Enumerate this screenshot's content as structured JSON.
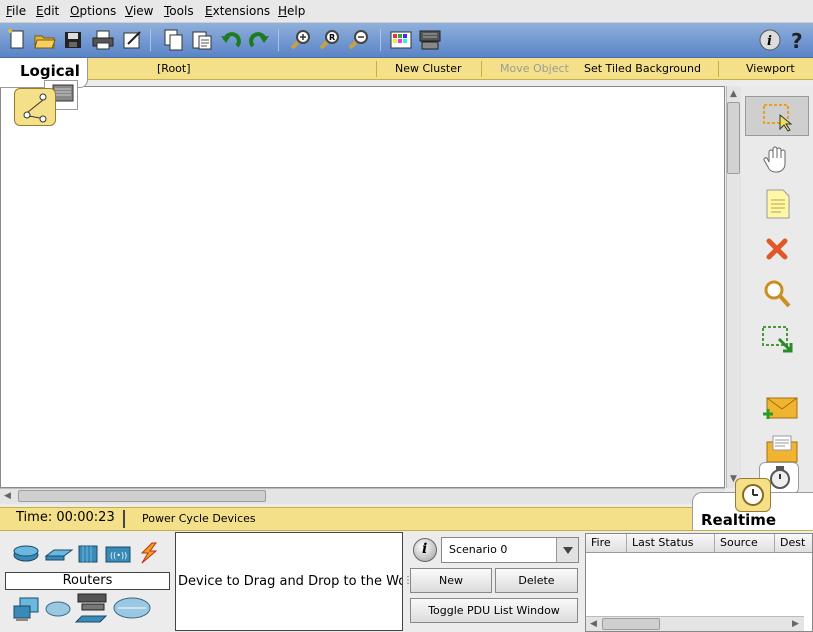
{
  "menubar": {
    "items": [
      {
        "label": "File"
      },
      {
        "label": "Edit"
      },
      {
        "label": "Options"
      },
      {
        "label": "View"
      },
      {
        "label": "Tools"
      },
      {
        "label": "Extensions"
      },
      {
        "label": "Help"
      }
    ]
  },
  "toolbar": {
    "buttons": [
      "new-icon",
      "open-icon",
      "save-icon",
      "print-icon",
      "activity-wizard-icon",
      "copy-icon",
      "paste-icon",
      "undo-icon",
      "redo-icon",
      "zoom-in-icon",
      "zoom-reset-icon",
      "zoom-out-icon",
      "palette-icon",
      "custom-device-icon",
      "info-icon",
      "help-icon"
    ]
  },
  "logicalbar": {
    "tab_label": "Logical",
    "root": "[Root]",
    "new_cluster": "New Cluster",
    "move_object": "Move Object",
    "set_tiled_background": "Set Tiled Background",
    "viewport": "Viewport"
  },
  "status": {
    "time": "Time: 00:00:23",
    "power_cycle": "Power Cycle Devices",
    "realtime_label": "Realtime"
  },
  "devices": {
    "selected_category": "Routers",
    "drag_hint": "Device to Drag and Drop to the Wo"
  },
  "scenario": {
    "selected": "Scenario 0",
    "new_label": "New",
    "delete_label": "Delete",
    "toggle_label": "Toggle PDU List Window"
  },
  "pdu_table": {
    "columns": [
      "Fire",
      "Last Status",
      "Source",
      "Dest"
    ]
  },
  "colors": {
    "toolbar_blue": "#5a84c6",
    "bar_yellow": "#f5e08a"
  }
}
